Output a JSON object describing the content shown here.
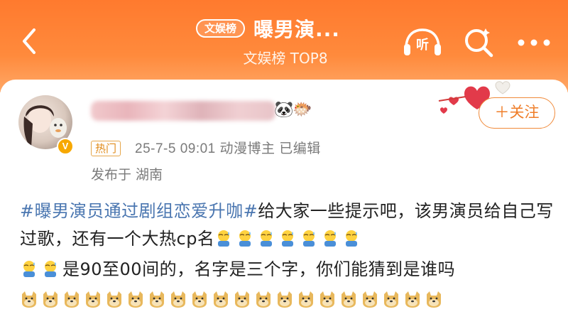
{
  "header": {
    "badge": "文娱榜",
    "title": "曝男演...",
    "subtitle": "文娱榜 TOP8",
    "listen_label": "听"
  },
  "post": {
    "hot_tag": "热门",
    "meta": "25-7-5 09:01  动漫博主  已编辑",
    "location": "发布于 湖南",
    "follow_label": "＋关注",
    "verified_mark": "V",
    "topic": "#曝男演员通过剧组恋爱升咖#",
    "text1": "给大家一些提示吧，该男演员给自己写过歌，还有一个大热cp名",
    "text2": "是90至00间的，名字是三个字，你们能猜到是谁吗"
  },
  "colors": {
    "header_orange": "#ff7a2e",
    "topic_blue": "#4a76b0",
    "follow_orange": "#ef7d28"
  },
  "icons": [
    "back-icon",
    "headphones-icon",
    "search-icon",
    "more-icon",
    "heart-icon",
    "panda-emoji-icon",
    "fish-emoji-icon",
    "sweat-emoji-icon",
    "doge-emoji-icon"
  ]
}
